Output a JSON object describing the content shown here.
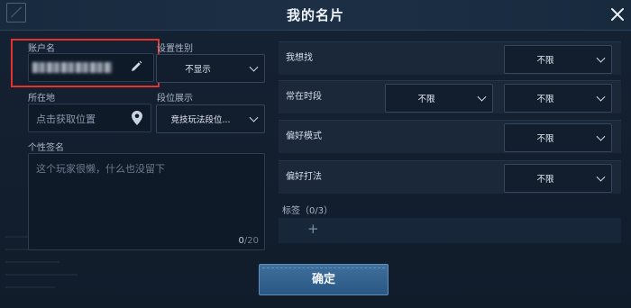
{
  "window": {
    "title": "我的名片"
  },
  "left": {
    "account": {
      "label": "账户名"
    },
    "gender": {
      "label": "设置性别",
      "value": "不显示"
    },
    "location": {
      "label": "所在地",
      "placeholder": "点击获取位置"
    },
    "rank": {
      "label": "段位展示",
      "value": "竞技玩法段位..."
    },
    "signature": {
      "label": "个性签名",
      "placeholder": "这个玩家很懒，什么也没留下",
      "count": "0",
      "max": "/20"
    }
  },
  "right": {
    "rows": [
      {
        "label": "我想找",
        "value": "不限"
      },
      {
        "label": "常在时段",
        "value_start": "不限",
        "value_end": "不限"
      },
      {
        "label": "偏好模式",
        "value": "不限"
      },
      {
        "label": "偏好打法",
        "value": "不限"
      }
    ],
    "tags": {
      "label": "标签（0/3）",
      "add": "+"
    }
  },
  "footer": {
    "confirm_label": "确定"
  },
  "icons": {
    "close": "close-icon",
    "edit": "pencil-icon",
    "location": "location-pin-icon",
    "chevron": "chevron-down-icon"
  },
  "colors": {
    "highlight_box": "#e0342c",
    "confirm_button": "#2f5f8e",
    "background": "#111c2b"
  }
}
